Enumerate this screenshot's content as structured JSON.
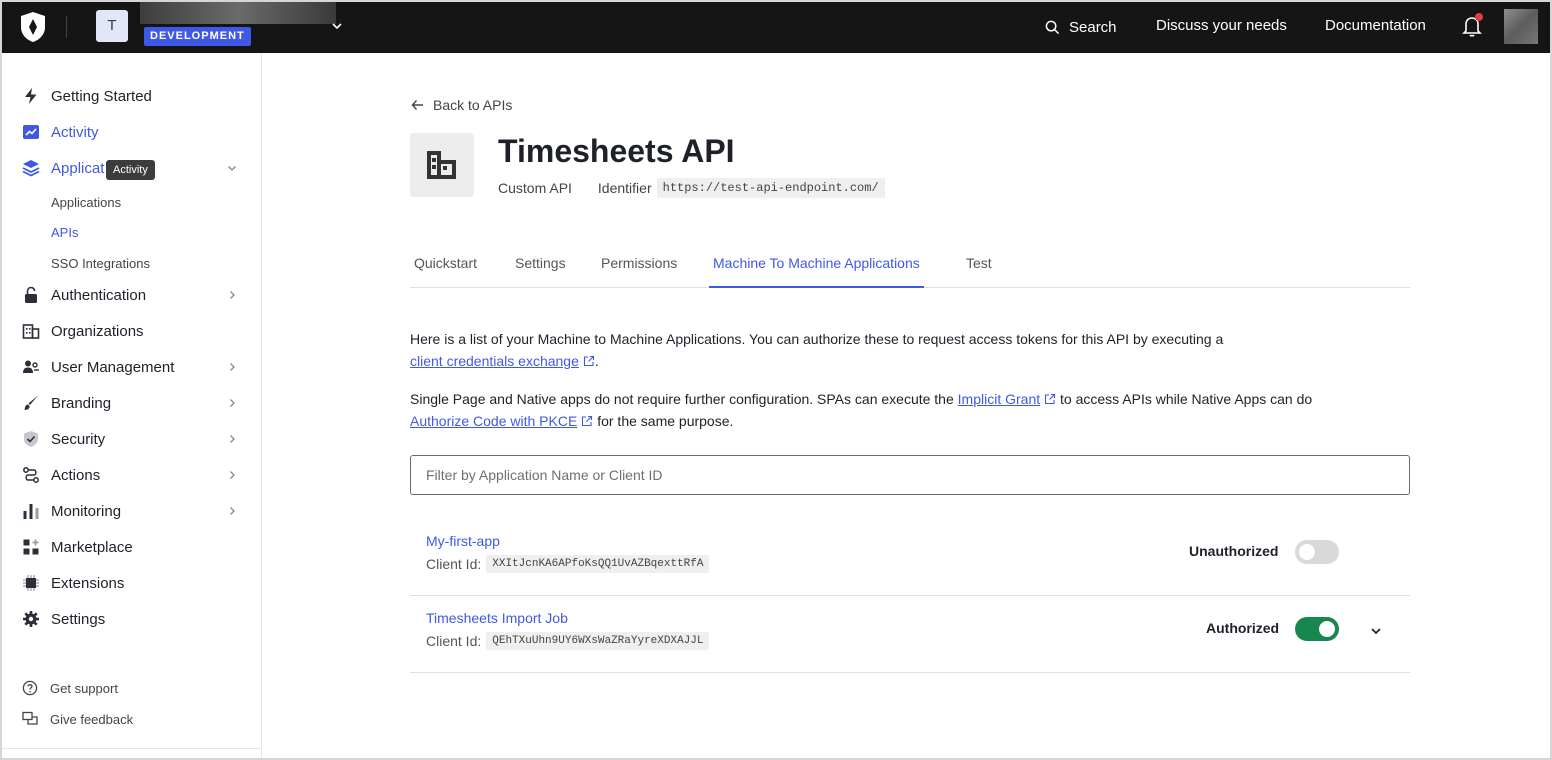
{
  "topbar": {
    "tenant_initial": "T",
    "environment_badge": "DEVELOPMENT",
    "search_label": "Search",
    "discuss_label": "Discuss your needs",
    "docs_label": "Documentation"
  },
  "sidebar": {
    "items": [
      {
        "label": "Getting Started",
        "icon": "bolt-icon"
      },
      {
        "label": "Activity",
        "icon": "activity-chart-icon"
      },
      {
        "label": "Applicat",
        "icon": "layers-icon"
      },
      {
        "label": "Authentication",
        "icon": "lock-icon"
      },
      {
        "label": "Organizations",
        "icon": "building-icon"
      },
      {
        "label": "User Management",
        "icon": "users-icon"
      },
      {
        "label": "Branding",
        "icon": "brush-icon"
      },
      {
        "label": "Security",
        "icon": "shield-icon"
      },
      {
        "label": "Actions",
        "icon": "actions-flow-icon"
      },
      {
        "label": "Monitoring",
        "icon": "bar-chart-icon"
      },
      {
        "label": "Marketplace",
        "icon": "marketplace-icon"
      },
      {
        "label": "Extensions",
        "icon": "chip-icon"
      },
      {
        "label": "Settings",
        "icon": "gear-icon"
      }
    ],
    "sub_items": [
      "Applications",
      "APIs",
      "SSO Integrations"
    ],
    "tooltip": "Activity",
    "footer": [
      "Get support",
      "Give feedback"
    ]
  },
  "main": {
    "back_label": "Back to APIs",
    "title": "Timesheets API",
    "api_type": "Custom API",
    "identifier_label": "Identifier",
    "identifier_value": "https://test-api-endpoint.com/",
    "tabs": [
      "Quickstart",
      "Settings",
      "Permissions",
      "Machine To Machine Applications",
      "Test"
    ],
    "active_tab": "Machine To Machine Applications",
    "para1_text": "Here is a list of your Machine to Machine Applications. You can authorize these to request access tokens for this API by executing a",
    "para1_link": "client credentials exchange",
    "para1_end": ".",
    "para2_text": "Single Page and Native apps do not require further configuration. SPAs can execute the",
    "para2_link1": "Implicit Grant",
    "para2_mid": "to access APIs while Native Apps can do",
    "para2_link2": "Authorize Code with PKCE",
    "para2_end": "for the same purpose.",
    "filter_placeholder": "Filter by Application Name or Client ID",
    "client_id_label": "Client Id:",
    "apps": [
      {
        "name": "My-first-app",
        "client_id": "XXItJcnKA6APfoKsQQ1UvAZBqexttRfA",
        "status": "Unauthorized",
        "authorized": false
      },
      {
        "name": "Timesheets Import Job",
        "client_id": "QEhTXuUhn9UY6WXsWaZRaYyreXDXAJJL",
        "status": "Authorized",
        "authorized": true
      }
    ]
  },
  "colors": {
    "accent": "#3f59e4",
    "topbar": "#151515",
    "toggle_on": "#18874f",
    "toggle_off": "#d9d9d9"
  }
}
